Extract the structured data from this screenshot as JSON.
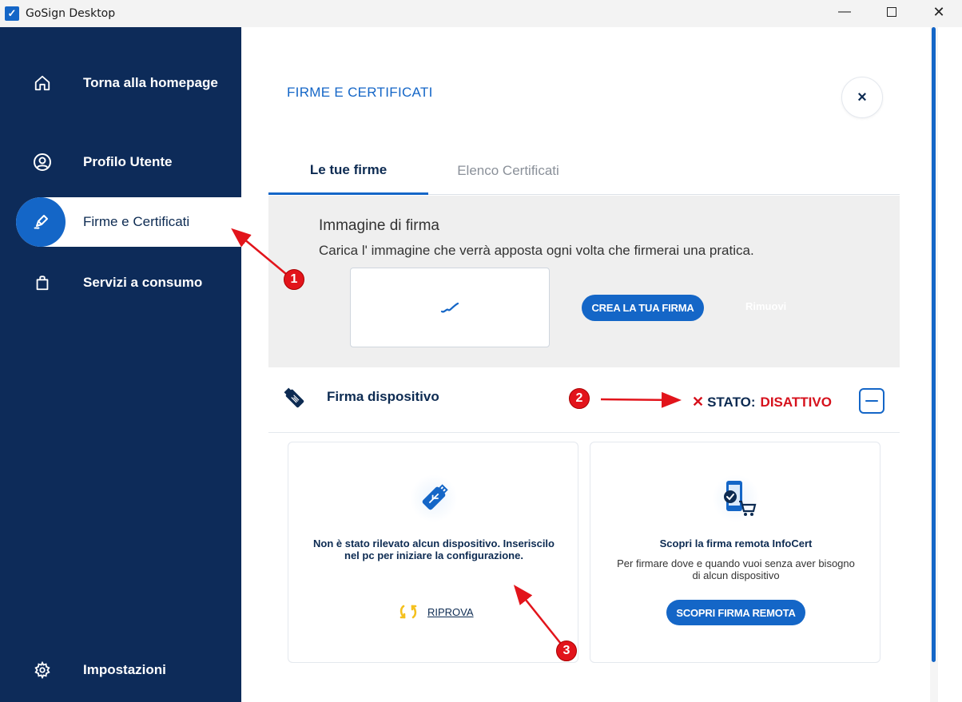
{
  "window": {
    "title": "GoSign Desktop",
    "minimize": "—",
    "close": "✕"
  },
  "sidebar": {
    "items": [
      {
        "label": "Torna alla homepage",
        "icon": "home-icon"
      },
      {
        "label": "Profilo Utente",
        "icon": "user-icon"
      },
      {
        "label": "Firme e Certificati",
        "icon": "signature-pen-icon",
        "active": true
      },
      {
        "label": "Servizi a consumo",
        "icon": "shopping-bag-icon"
      }
    ],
    "settings": {
      "label": "Impostazioni",
      "icon": "gear-icon"
    }
  },
  "main": {
    "title": "FIRME E CERTIFICATI",
    "close_label": "×",
    "tabs": [
      {
        "label": "Le tue firme",
        "active": true
      },
      {
        "label": "Elenco Certificati",
        "active": false
      }
    ],
    "signature_image": {
      "title": "Immagine di firma",
      "description": "Carica l' immagine che verrà apposta ogni volta che firmerai una pratica.",
      "create_button": "CREA LA TUA FIRMA",
      "remove_button": "Rimuovi"
    },
    "device_signature": {
      "label": "Firma dispositivo",
      "status_label": "STATO:",
      "status_value": "DISATTIVO",
      "status_icon": "✕"
    },
    "cards": {
      "device": {
        "text": "Non è stato rilevato alcun dispositivo. Inseriscilo nel pc per iniziare la configurazione.",
        "retry_label": "RIPROVA"
      },
      "remote": {
        "title": "Scopri la firma remota InfoCert",
        "text": "Per firmare dove e quando vuoi senza aver bisogno di alcun dispositivo",
        "button": "SCOPRI FIRMA REMOTA"
      }
    }
  },
  "annotations": [
    {
      "number": "1"
    },
    {
      "number": "2"
    },
    {
      "number": "3"
    }
  ],
  "colors": {
    "sidebar_bg": "#0d2b59",
    "accent": "#1466c7",
    "status_red": "#d6111c",
    "annotation_red": "#e2141b"
  }
}
